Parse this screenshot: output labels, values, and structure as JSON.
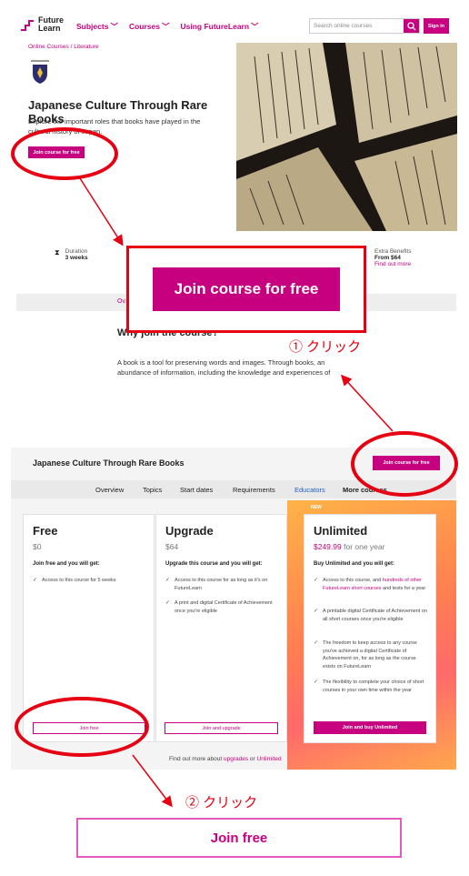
{
  "header": {
    "logo_line1": "Future",
    "logo_line2": "Learn",
    "nav": [
      "Subjects",
      "Courses",
      "Using FutureLearn"
    ],
    "search_placeholder": "Search online courses",
    "signin_label": "Sign in"
  },
  "course": {
    "breadcrumb": "Online Courses / Literature",
    "title": "Japanese Culture Through Rare Books",
    "description": "Explore the important roles that books have played in the cultural history of Japan.",
    "join_label": "Join course for free"
  },
  "stats": {
    "duration_label": "Duration",
    "duration_value": "3 weeks",
    "extra_label": "Extra Benefits",
    "extra_value": "From $64",
    "extra_link": "Find out more"
  },
  "tabs_top": {
    "overview_partial": "Ov"
  },
  "why": {
    "heading": "Why join the course?",
    "body": "A book is a tool for preserving words and images. Through books, an abundance of information, including the knowledge and experiences of"
  },
  "callout": {
    "big_join": "Join course for free",
    "click1": "① クリック",
    "click2": "② クリック"
  },
  "sticky": {
    "title": "Japanese Culture Through Rare Books",
    "join_label": "Join course for free",
    "tabs": [
      "Overview",
      "Topics",
      "Start dates",
      "Requirements",
      "Educators",
      "More courses"
    ]
  },
  "plans": {
    "free": {
      "name": "Free",
      "price": "$0",
      "lead": "Join free and you will get:",
      "features": [
        "Access to this course for 5 weeks"
      ],
      "button": "Join free"
    },
    "upgrade": {
      "name": "Upgrade",
      "price": "$64",
      "lead": "Upgrade this course and you will get:",
      "features": [
        "Access to this course for as long as it's on FutureLearn",
        "A print and digital Certificate of Achievement once you're eligible"
      ],
      "button": "Join and upgrade"
    },
    "unlimited": {
      "badge": "NEW",
      "name": "Unlimited",
      "price": "$249.99",
      "price_suffix": "for one year",
      "lead": "Buy Unlimited and you will get:",
      "f1_pre": "Access to this course, and ",
      "f1_link": "hundreds of other FutureLearn short courses",
      "f1_post": " and tests for a year",
      "features_rest": [
        "A printable digital Certificate of Achievement on all short courses once you're eligible",
        "The freedom to keep access to any course you've achieved a digital Certificate of Achievement on, for as long as the course exists on FutureLearn",
        "The flexibility to complete your choice of short courses in your own time within the year"
      ],
      "button": "Join and buy Unlimited"
    },
    "footer_pre": "Find out more about ",
    "footer_upgrades": "upgrades",
    "footer_or": " or ",
    "footer_unlimited": "Unlimited"
  },
  "big_joinfree": "Join free",
  "colors": {
    "brand": "#c6007e",
    "annotation": "#e60012"
  }
}
